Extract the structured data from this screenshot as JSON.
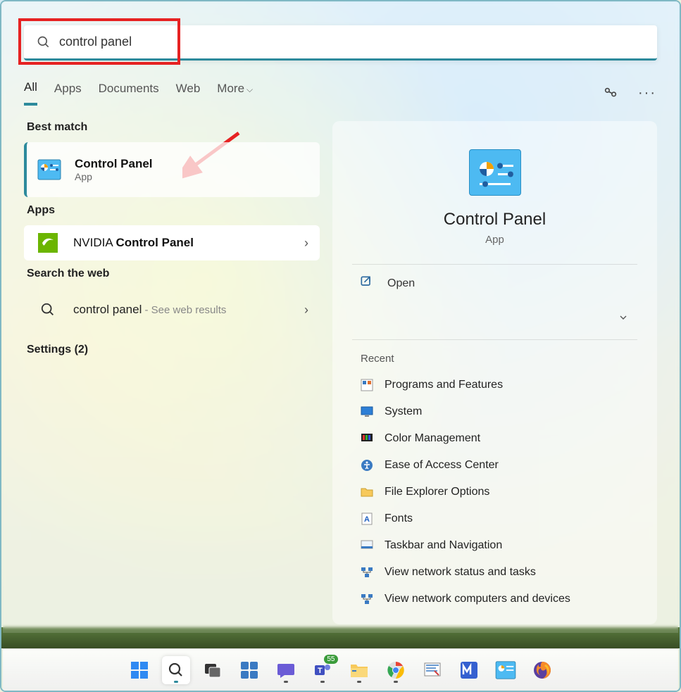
{
  "search": {
    "value": "control panel"
  },
  "tabs": {
    "items": [
      "All",
      "Apps",
      "Documents",
      "Web",
      "More"
    ],
    "active": "All"
  },
  "left": {
    "best_match_header": "Best match",
    "best": {
      "title": "Control Panel",
      "subtitle": "App"
    },
    "apps_header": "Apps",
    "app_result": {
      "prefix": "NVIDIA ",
      "bold": "Control Panel"
    },
    "web_header": "Search the web",
    "web": {
      "query": "control panel",
      "hint": " - See web results"
    },
    "settings_header": "Settings (2)"
  },
  "right": {
    "title": "Control Panel",
    "subtitle": "App",
    "open_label": "Open",
    "recent_header": "Recent",
    "recent": [
      "Programs and Features",
      "System",
      "Color Management",
      "Ease of Access Center",
      "File Explorer Options",
      "Fonts",
      "Taskbar and Navigation",
      "View network status and tasks",
      "View network computers and devices"
    ]
  },
  "taskbar": {
    "chat_badge": "55",
    "items": [
      "start",
      "search",
      "task-view",
      "widgets",
      "chat",
      "teams",
      "file-explorer",
      "chrome",
      "snip",
      "app-m",
      "control-panel",
      "firefox"
    ]
  }
}
